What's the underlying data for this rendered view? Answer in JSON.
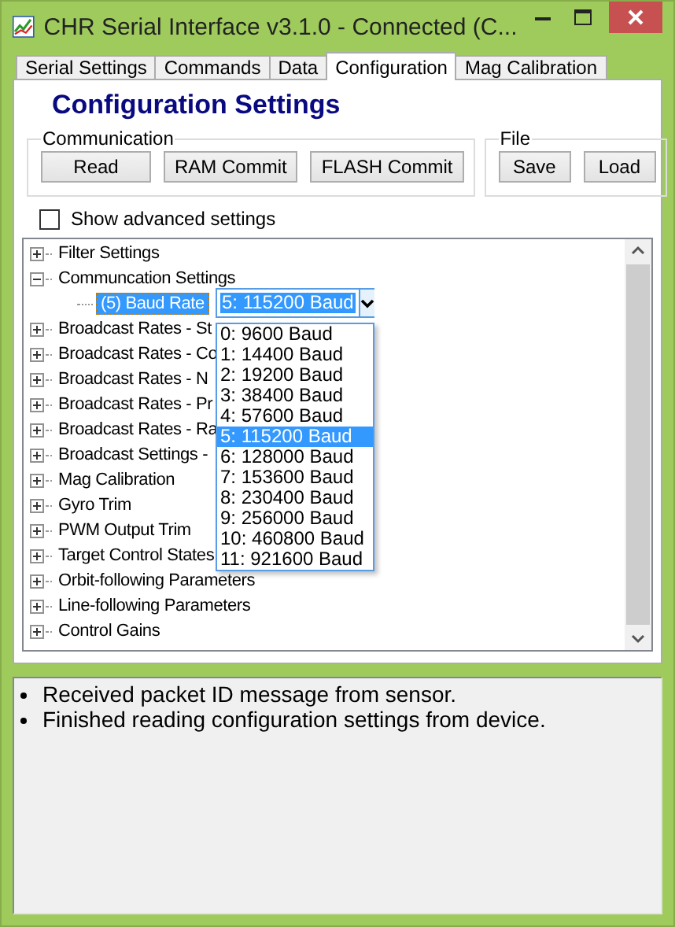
{
  "window": {
    "title": "CHR Serial Interface v3.1.0 - Connected (C..."
  },
  "tabs": [
    {
      "label": "Serial Settings",
      "selected": false
    },
    {
      "label": "Commands",
      "selected": false
    },
    {
      "label": "Data",
      "selected": false
    },
    {
      "label": "Configuration",
      "selected": true
    },
    {
      "label": "Mag Calibration",
      "selected": false
    }
  ],
  "heading": "Configuration Settings",
  "groups": [
    {
      "title": "Communication",
      "buttons": [
        "Read",
        "RAM Commit",
        "FLASH Commit"
      ]
    },
    {
      "title": "File",
      "buttons": [
        "Save",
        "Load"
      ]
    }
  ],
  "advanced_checkbox": {
    "label": "Show advanced settings",
    "checked": false
  },
  "tree": [
    {
      "label": "Filter Settings",
      "expanded": false
    },
    {
      "label": "Communcation Settings",
      "expanded": true,
      "children": [
        {
          "label": "(5) Baud Rate",
          "selected": true
        }
      ]
    },
    {
      "label": "Broadcast Rates - St",
      "expanded": false
    },
    {
      "label": "Broadcast Rates - Co",
      "expanded": false
    },
    {
      "label": "Broadcast Rates - N",
      "expanded": false
    },
    {
      "label": "Broadcast Rates - Pr",
      "expanded": false
    },
    {
      "label": "Broadcast Rates - Ra",
      "expanded": false
    },
    {
      "label": "Broadcast Settings -",
      "expanded": false
    },
    {
      "label": "Mag Calibration",
      "expanded": false
    },
    {
      "label": "Gyro Trim",
      "expanded": false
    },
    {
      "label": "PWM Output Trim",
      "expanded": false
    },
    {
      "label": "Target Control States",
      "expanded": false
    },
    {
      "label": "Orbit-following Parameters",
      "expanded": false
    },
    {
      "label": "Line-following Parameters",
      "expanded": false
    },
    {
      "label": "Control Gains",
      "expanded": false
    }
  ],
  "baud_combo": {
    "value": "5: 115200 Baud",
    "options": [
      {
        "label": "0: 9600 Baud",
        "selected": false
      },
      {
        "label": "1: 14400 Baud",
        "selected": false
      },
      {
        "label": "2: 19200 Baud",
        "selected": false
      },
      {
        "label": "3: 38400 Baud",
        "selected": false
      },
      {
        "label": "4: 57600 Baud",
        "selected": false
      },
      {
        "label": "5: 115200 Baud",
        "selected": true
      },
      {
        "label": "6: 128000 Baud",
        "selected": false
      },
      {
        "label": "7: 153600 Baud",
        "selected": false
      },
      {
        "label": "8: 230400 Baud",
        "selected": false
      },
      {
        "label": "9: 256000 Baud",
        "selected": false
      },
      {
        "label": "10: 460800 Baud",
        "selected": false
      },
      {
        "label": "11: 921600 Baud",
        "selected": false
      }
    ]
  },
  "log": [
    "Received packet ID message from sensor.",
    "Finished reading configuration settings from device."
  ]
}
